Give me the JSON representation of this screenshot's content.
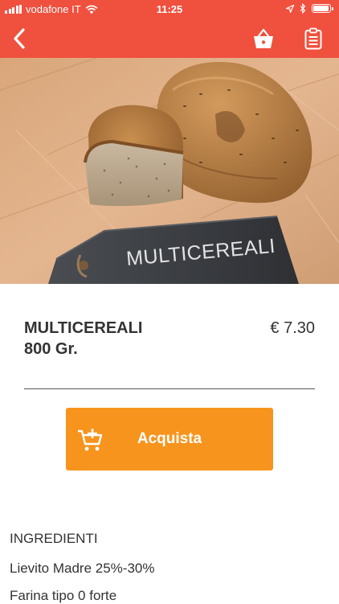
{
  "status_bar": {
    "carrier": "vodafone IT",
    "time": "11:25",
    "battery_level": 0.95
  },
  "nav": {
    "back_icon": "chevron-left-icon",
    "cart_icon": "basket-icon",
    "list_icon": "clipboard-icon"
  },
  "hero": {
    "sign_text": "MULTICEREALI"
  },
  "product": {
    "name": "MULTICEREALI",
    "weight": "800 Gr.",
    "price": "€ 7.30"
  },
  "buy_button": {
    "label": "Acquista",
    "icon": "add-to-cart-icon"
  },
  "ingredients": {
    "title": "INGREDIENTI",
    "items": [
      "Lievito Madre 25%-30%",
      "Farina tipo 0 forte"
    ]
  },
  "colors": {
    "header": "#f0503e",
    "button": "#f7941d"
  }
}
